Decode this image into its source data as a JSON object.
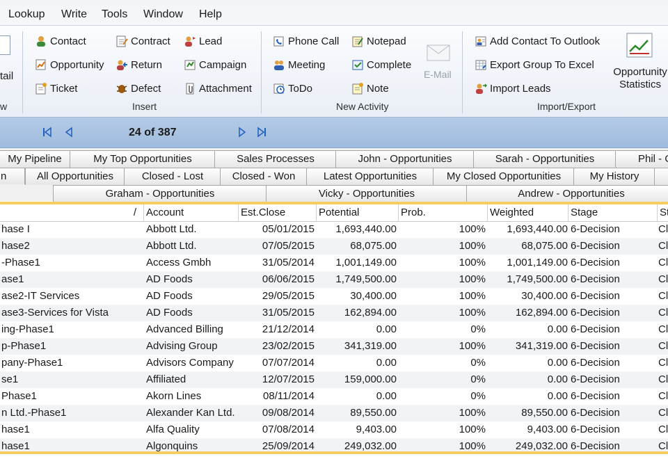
{
  "menu": [
    "Lookup",
    "Write",
    "Tools",
    "Window",
    "Help"
  ],
  "ribbon": {
    "left_partial": {
      "label": "tail",
      "group": "w"
    },
    "insert": {
      "items": [
        "Contact",
        "Contract",
        "Lead",
        "Opportunity",
        "Return",
        "Campaign",
        "Ticket",
        "Defect",
        "Attachment"
      ],
      "group": "Insert"
    },
    "new_activity": {
      "items": [
        "Phone Call",
        "Notepad",
        "Meeting",
        "Complete",
        "ToDo",
        "Note"
      ],
      "email": "E-Mail",
      "group": "New Activity"
    },
    "import_export": {
      "items": [
        "Add Contact To Outlook",
        "Export Group To Excel",
        "Import Leads"
      ],
      "group": "Import/Export"
    },
    "opportunity_statistics": {
      "line1": "Opportunity",
      "line2": "Statistics"
    }
  },
  "navigation": {
    "record_position": "24 of 387"
  },
  "tabs": {
    "row1": [
      "My Pipeline",
      "My Top Opportunities",
      "Sales Processes",
      "John - Opportunities",
      "Sarah - Opportunities",
      "Phil - O"
    ],
    "row2": [
      "n",
      "All Opportunities",
      "Closed - Lost",
      "Closed - Won",
      "Latest Opportunities",
      "My Closed Opportunities",
      "My History"
    ],
    "row3": [
      "Graham - Opportunities",
      "Vicky - Opportunities",
      "Andrew - Opportunities"
    ]
  },
  "grid": {
    "sort_indicator": "/",
    "columns": [
      "Account",
      "Est.Close",
      "Potential",
      "Prob.",
      "Weighted",
      "Stage",
      "St"
    ],
    "rows": [
      {
        "name": "hase I",
        "account": "Abbott Ltd.",
        "close": "05/01/2015",
        "potential": "1,693,440.00",
        "prob": "100%",
        "weighted": "1,693,440.00",
        "stage": "6-Decision",
        "st": "Cl"
      },
      {
        "name": "hase2",
        "account": "Abbott Ltd.",
        "close": "07/05/2015",
        "potential": "68,075.00",
        "prob": "100%",
        "weighted": "68,075.00",
        "stage": "6-Decision",
        "st": "Cl"
      },
      {
        "name": "-Phase1",
        "account": "Access Gmbh",
        "close": "31/05/2014",
        "potential": "1,001,149.00",
        "prob": "100%",
        "weighted": "1,001,149.00",
        "stage": "6-Decision",
        "st": "Cl"
      },
      {
        "name": "ase1",
        "account": "AD Foods",
        "close": "06/06/2015",
        "potential": "1,749,500.00",
        "prob": "100%",
        "weighted": "1,749,500.00",
        "stage": "6-Decision",
        "st": "Cl"
      },
      {
        "name": "ase2-IT Services",
        "account": "AD Foods",
        "close": "29/05/2015",
        "potential": "30,400.00",
        "prob": "100%",
        "weighted": "30,400.00",
        "stage": "6-Decision",
        "st": "Cl"
      },
      {
        "name": "ase3-Services for Vista",
        "account": "AD Foods",
        "close": "31/05/2015",
        "potential": "162,894.00",
        "prob": "100%",
        "weighted": "162,894.00",
        "stage": "6-Decision",
        "st": "Cl"
      },
      {
        "name": "ing-Phase1",
        "account": "Advanced Billing",
        "close": "21/12/2014",
        "potential": "0.00",
        "prob": "0%",
        "weighted": "0.00",
        "stage": "6-Decision",
        "st": "Cl"
      },
      {
        "name": "p-Phase1",
        "account": "Advising Group",
        "close": "23/02/2015",
        "potential": "341,319.00",
        "prob": "100%",
        "weighted": "341,319.00",
        "stage": "6-Decision",
        "st": "Cl"
      },
      {
        "name": "pany-Phase1",
        "account": "Advisors Company",
        "close": "07/07/2014",
        "potential": "0.00",
        "prob": "0%",
        "weighted": "0.00",
        "stage": "6-Decision",
        "st": "Cl"
      },
      {
        "name": "se1",
        "account": "Affiliated",
        "close": "12/07/2015",
        "potential": "159,000.00",
        "prob": "0%",
        "weighted": "0.00",
        "stage": "6-Decision",
        "st": "Cl"
      },
      {
        "name": "Phase1",
        "account": "Akorn Lines",
        "close": "08/11/2014",
        "potential": "0.00",
        "prob": "0%",
        "weighted": "0.00",
        "stage": "6-Decision",
        "st": "Cl"
      },
      {
        "name": "n Ltd.-Phase1",
        "account": "Alexander Kan Ltd.",
        "close": "09/08/2014",
        "potential": "89,550.00",
        "prob": "100%",
        "weighted": "89,550.00",
        "stage": "6-Decision",
        "st": "Cl"
      },
      {
        "name": "hase1",
        "account": "Alfa Quality",
        "close": "07/08/2014",
        "potential": "9,403.00",
        "prob": "100%",
        "weighted": "9,403.00",
        "stage": "6-Decision",
        "st": "Cl"
      },
      {
        "name": "hase1",
        "account": "Algonquins",
        "close": "25/09/2014",
        "potential": "249,032.00",
        "prob": "100%",
        "weighted": "249,032.00",
        "stage": "6-Decision",
        "st": "Cl"
      }
    ]
  },
  "colors": {
    "highlight": "#f3cf63",
    "nav_bar": "#a9c2e2",
    "ribbon": "#eef2f8"
  }
}
